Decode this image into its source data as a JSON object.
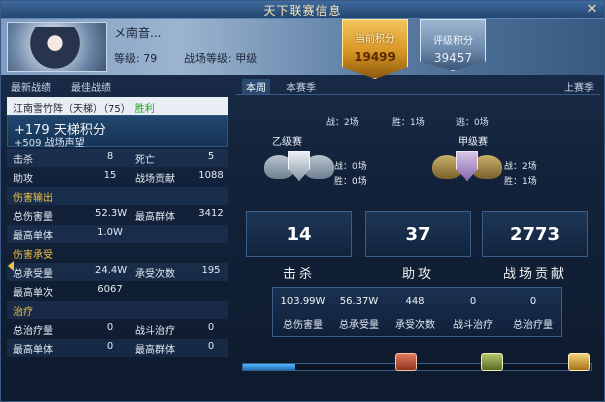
{
  "window": {
    "title": "天下联赛信息"
  },
  "player": {
    "name": "メ南音...",
    "level": "等级: 79",
    "battle_level": "战场等级: 甲级"
  },
  "badges": {
    "current_label": "当前积分",
    "current_value": "19499",
    "rank_label": "评级积分",
    "rank_value": "39457"
  },
  "left": {
    "tabs": [
      "最新战绩",
      "最佳战绩"
    ],
    "match": {
      "text": "江南雪竹阵（天梯）（75）",
      "result": "胜利"
    },
    "points": "+179 天梯积分",
    "reputation": "+509 战场声望",
    "rows": [
      {
        "l1": "击杀",
        "v1": "8",
        "l2": "死亡",
        "v2": "5"
      },
      {
        "l1": "助攻",
        "v1": "15",
        "l2": "战场贡献",
        "v2": "1088"
      },
      {
        "section": "伤害输出"
      },
      {
        "l1": "总伤害量",
        "v1": "52.3W",
        "l2": "最高群体",
        "v2": "3412"
      },
      {
        "l1": "最高单体",
        "v1": "1.0W",
        "l2": "",
        "v2": ""
      },
      {
        "section": "伤害承受"
      },
      {
        "l1": "总承受量",
        "v1": "24.4W",
        "l2": "承受次数",
        "v2": "195"
      },
      {
        "l1": "最高单次",
        "v1": "6067",
        "l2": "",
        "v2": ""
      },
      {
        "section": "治疗"
      },
      {
        "l1": "总治疗量",
        "v1": "0",
        "l2": "战斗治疗",
        "v2": "0"
      },
      {
        "l1": "最高单体",
        "v1": "0",
        "l2": "最高群体",
        "v2": "0"
      }
    ]
  },
  "right": {
    "tabs": [
      "本周",
      "本赛季",
      "上赛季"
    ],
    "summary": {
      "battles": "战：2场",
      "wins": "胜：1场",
      "escapes": "逃：0场"
    },
    "tiers": [
      {
        "name": "乙级赛",
        "battles": "战：0场",
        "wins": "胜：0场"
      },
      {
        "name": "甲级赛",
        "battles": "战：2场",
        "wins": "胜：1场"
      }
    ],
    "big": [
      {
        "value": "14",
        "label": "击杀"
      },
      {
        "value": "37",
        "label": "助攻"
      },
      {
        "value": "2773",
        "label": "战场贡献"
      }
    ],
    "details": [
      {
        "value": "103.99W",
        "label": "总伤害量"
      },
      {
        "value": "56.37W",
        "label": "总承受量"
      },
      {
        "value": "448",
        "label": "承受次数"
      },
      {
        "value": "0",
        "label": "战斗治疗"
      },
      {
        "value": "0",
        "label": "总治疗量"
      }
    ],
    "progress_fraction": 0.15
  },
  "icons": {
    "close": "close-icon",
    "chest1": "red-chest-icon",
    "chest2": "green-chest-icon",
    "chest3": "gold-chest-icon"
  }
}
